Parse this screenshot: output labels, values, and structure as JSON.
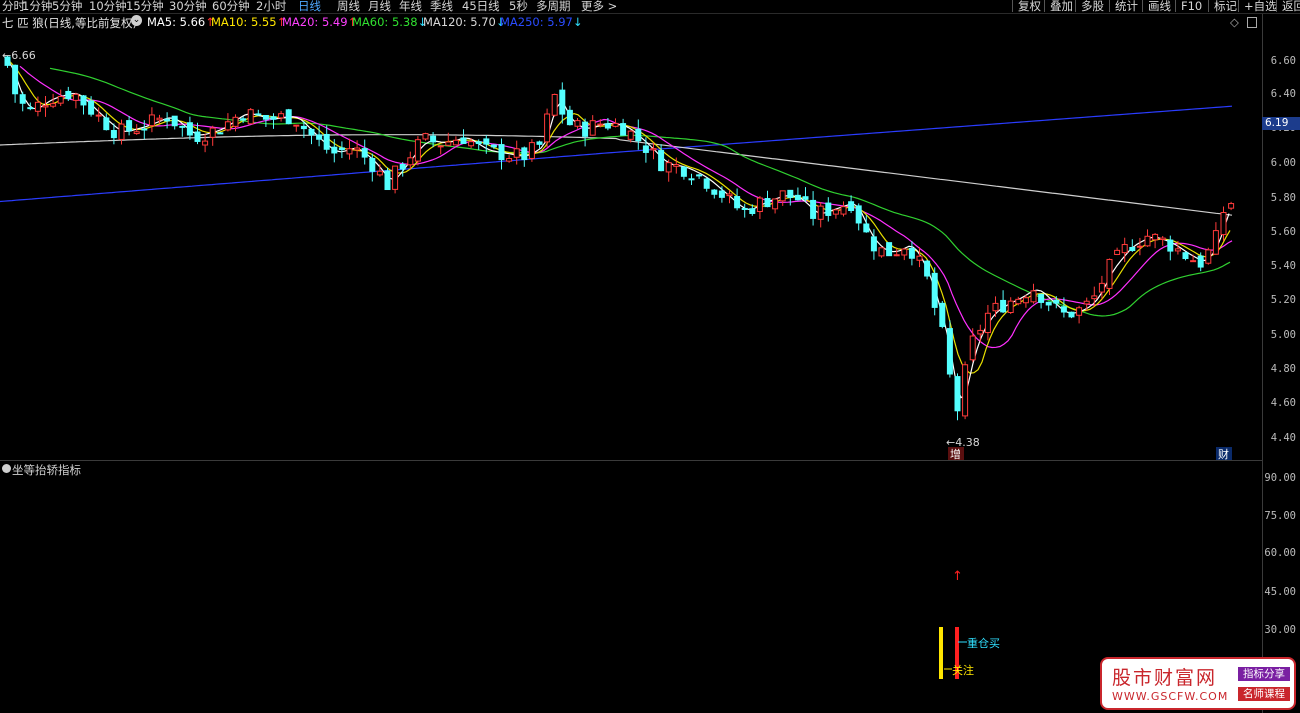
{
  "toolbar": {
    "timeframes": [
      "分时",
      "1分钟",
      "5分钟",
      "10分钟",
      "15分钟",
      "30分钟",
      "60分钟",
      "2小时",
      "日线",
      "周线",
      "月线",
      "年线",
      "季线",
      "45日线",
      "5秒",
      "多周期",
      "更多 >"
    ],
    "active_index": 8,
    "right_buttons": [
      "复权",
      "叠加",
      "多股",
      "统计",
      "画线",
      "F10",
      "标记",
      "+自选",
      "返回"
    ]
  },
  "chart_header": {
    "title": "七 匹 狼(日线,等比前复权)",
    "ma": [
      {
        "label": "MA5: 5.66",
        "arrow": "↑",
        "color": "#ffffff",
        "arrow_color": "#ff3030"
      },
      {
        "label": "MA10: 5.55",
        "arrow": "↑",
        "color": "#ffe600",
        "arrow_color": "#ff3030"
      },
      {
        "label": "MA20: 5.49",
        "arrow": "↑",
        "color": "#ff40ff",
        "arrow_color": "#ff3030"
      },
      {
        "label": "MA60: 5.38",
        "arrow": "↓",
        "color": "#30e030",
        "arrow_color": "#30e0ff"
      },
      {
        "label": "MA120: 5.70",
        "arrow": "↓",
        "color": "#d8d8d8",
        "arrow_color": "#30e0ff"
      },
      {
        "label": "MA250: 5.97",
        "arrow": "↓",
        "color": "#2a4cff",
        "arrow_color": "#30e0ff"
      }
    ]
  },
  "price_axis": [
    "6.60",
    "6.40",
    "6.20",
    "6.00",
    "5.80",
    "5.60",
    "5.40",
    "5.20",
    "5.00",
    "4.80",
    "4.60",
    "4.40"
  ],
  "current_price": "6.19",
  "high_marker": "6.66",
  "low_marker": "4.38",
  "markers": {
    "zeng": "增",
    "cai": "财"
  },
  "indicator": {
    "title": "坐等抬轿指标",
    "axis": [
      "90.00",
      "75.00",
      "60.00",
      "45.00",
      "30.00"
    ],
    "signal_heavy": "重仓买",
    "signal_watch": "关注"
  },
  "watermark": {
    "name": "股市财富网",
    "url": "WWW.GSCFW.COM",
    "tag1": "指标分享",
    "tag2": "名师课程"
  },
  "colors": {
    "up": "#ff3b3b",
    "down": "#54ffff",
    "ma5": "#ffffff",
    "ma10": "#e8e000",
    "ma20": "#ff30ff",
    "ma60": "#30d030",
    "ma120": "#cfcfcf",
    "ma250": "#2a3cff"
  },
  "chart_data": {
    "type": "candlestick",
    "price_range": [
      4.36,
      6.74
    ],
    "ma_values": {
      "MA5": 5.66,
      "MA10": 5.55,
      "MA20": 5.49,
      "MA60": 5.38,
      "MA120": 5.7,
      "MA250": 5.97
    },
    "indicator_range": [
      0,
      98
    ]
  }
}
